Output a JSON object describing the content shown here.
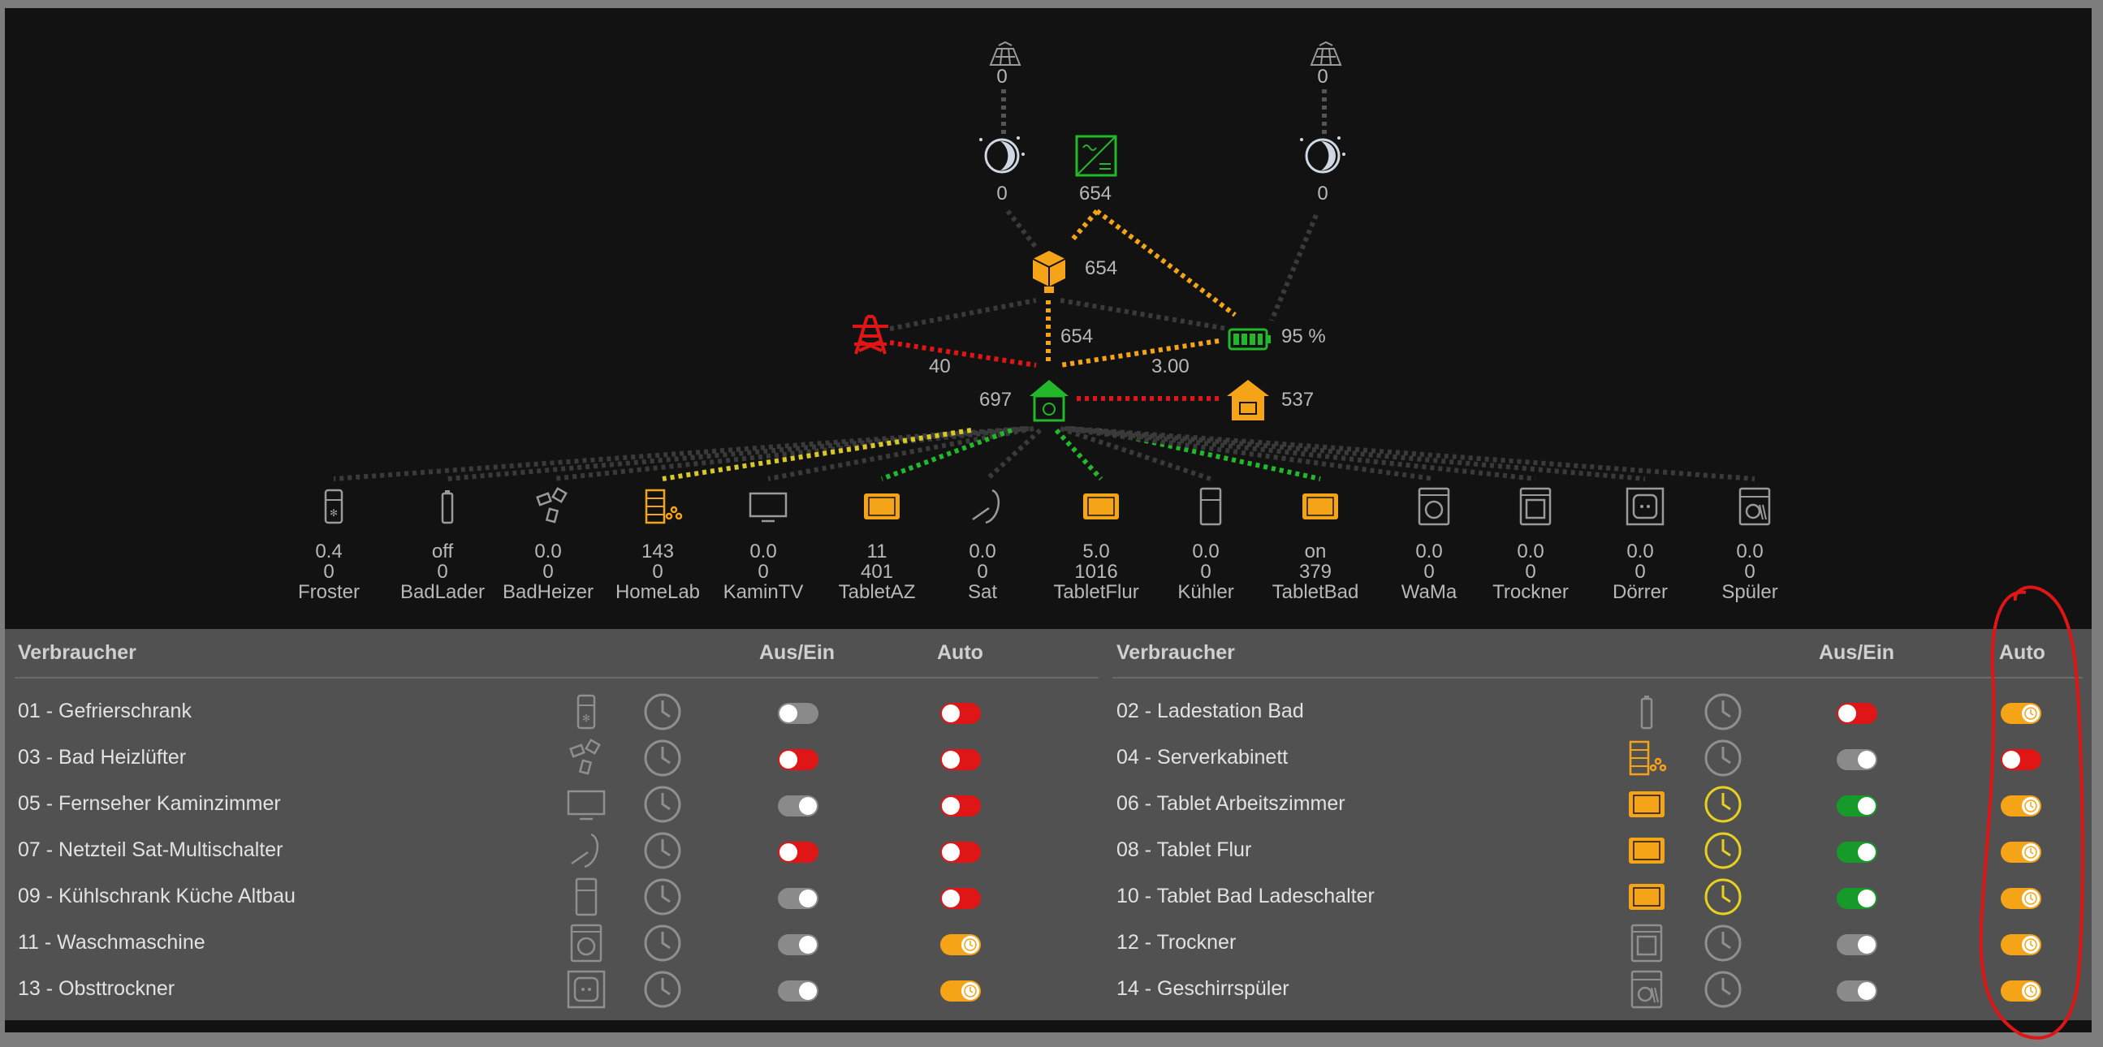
{
  "colors": {
    "bg": "#121212",
    "panel": "#515151",
    "orange": "#f4a416",
    "green": "#22b82a",
    "red": "#e01616",
    "grey": "#8a8a8a",
    "yellow": "#e8d020"
  },
  "flow": {
    "pv_left": {
      "value": "0",
      "mid": "0"
    },
    "pv_right": {
      "value": "0",
      "mid": "0"
    },
    "inverter": {
      "value": "654"
    },
    "hub": {
      "value": "654",
      "down": "654"
    },
    "grid": {
      "value": "40"
    },
    "battery": {
      "value": "95 %",
      "flow": "3.00"
    },
    "house": {
      "value": "697"
    },
    "heatpump": {
      "value": "537"
    }
  },
  "devices": [
    {
      "icon": "freezer-icon",
      "v1": "0.4",
      "v2": "0",
      "name": "Froster"
    },
    {
      "icon": "battery-charger-icon",
      "v1": "off",
      "v2": "0",
      "name": "BadLader"
    },
    {
      "icon": "heater-icon",
      "v1": "0.0",
      "v2": "0",
      "name": "BadHeizer"
    },
    {
      "icon": "server-icon",
      "v1": "143",
      "v2": "0",
      "name": "HomeLab"
    },
    {
      "icon": "tv-icon",
      "v1": "0.0",
      "v2": "0",
      "name": "KaminTV"
    },
    {
      "icon": "tablet-icon",
      "v1": "11",
      "v2": "401",
      "name": "TabletAZ"
    },
    {
      "icon": "satellite-icon",
      "v1": "0.0",
      "v2": "0",
      "name": "Sat"
    },
    {
      "icon": "tablet-icon",
      "v1": "5.0",
      "v2": "1016",
      "name": "TabletFlur"
    },
    {
      "icon": "fridge-icon",
      "v1": "0.0",
      "v2": "0",
      "name": "Kühler"
    },
    {
      "icon": "tablet-icon",
      "v1": "on",
      "v2": "379",
      "name": "TabletBad"
    },
    {
      "icon": "washer-icon",
      "v1": "0.0",
      "v2": "0",
      "name": "WaMa"
    },
    {
      "icon": "dryer-icon",
      "v1": "0.0",
      "v2": "0",
      "name": "Trockner"
    },
    {
      "icon": "dehydrator-icon",
      "v1": "0.0",
      "v2": "0",
      "name": "Dörrer"
    },
    {
      "icon": "dishwasher-icon",
      "v1": "0.0",
      "v2": "0",
      "name": "Spüler"
    }
  ],
  "table": {
    "header": {
      "consumer": "Verbraucher",
      "onoff": "Aus/Ein",
      "auto": "Auto"
    },
    "left": [
      {
        "label": "01 - Gefrierschrank",
        "icon": "freezer-icon",
        "icon_active": false,
        "clock_active": false,
        "onoff": "off-grey",
        "auto": "off-red"
      },
      {
        "label": "03 - Bad Heizlüfter",
        "icon": "heater-icon",
        "icon_active": false,
        "clock_active": false,
        "onoff": "off-red",
        "auto": "off-red"
      },
      {
        "label": "05 - Fernseher Kaminzimmer",
        "icon": "tv-icon",
        "icon_active": false,
        "clock_active": false,
        "onoff": "on-grey",
        "auto": "off-red"
      },
      {
        "label": "07 - Netzteil Sat-Multischalter",
        "icon": "satellite-icon",
        "icon_active": false,
        "clock_active": false,
        "onoff": "off-red",
        "auto": "off-red"
      },
      {
        "label": "09 - Kühlschrank Küche Altbau",
        "icon": "fridge-icon",
        "icon_active": false,
        "clock_active": false,
        "onoff": "on-grey",
        "auto": "off-red"
      },
      {
        "label": "11 - Waschmaschine",
        "icon": "washer-icon",
        "icon_active": false,
        "clock_active": false,
        "onoff": "on-grey",
        "auto": "on-orange"
      },
      {
        "label": "13 - Obsttrockner",
        "icon": "dehydrator-icon",
        "icon_active": false,
        "clock_active": false,
        "onoff": "on-grey",
        "auto": "on-orange"
      }
    ],
    "right": [
      {
        "label": "02 - Ladestation Bad",
        "icon": "battery-charger-icon",
        "icon_active": false,
        "clock_active": false,
        "onoff": "off-red",
        "auto": "on-orange"
      },
      {
        "label": "04 - Serverkabinett",
        "icon": "server-icon",
        "icon_active": true,
        "clock_active": false,
        "onoff": "on-grey",
        "auto": "off-red"
      },
      {
        "label": "06 - Tablet Arbeitszimmer",
        "icon": "tablet-icon",
        "icon_active": true,
        "clock_active": true,
        "onoff": "on-green",
        "auto": "on-orange"
      },
      {
        "label": "08 - Tablet Flur",
        "icon": "tablet-icon",
        "icon_active": true,
        "clock_active": true,
        "onoff": "on-green",
        "auto": "on-orange"
      },
      {
        "label": "10 - Tablet Bad Ladeschalter",
        "icon": "tablet-icon",
        "icon_active": true,
        "clock_active": true,
        "onoff": "on-green",
        "auto": "on-orange"
      },
      {
        "label": "12 - Trockner",
        "icon": "dryer-icon",
        "icon_active": false,
        "clock_active": false,
        "onoff": "on-grey",
        "auto": "on-orange"
      },
      {
        "label": "14 - Geschirrspüler",
        "icon": "dishwasher-icon",
        "icon_active": false,
        "clock_active": false,
        "onoff": "on-grey",
        "auto": "on-orange"
      }
    ]
  }
}
